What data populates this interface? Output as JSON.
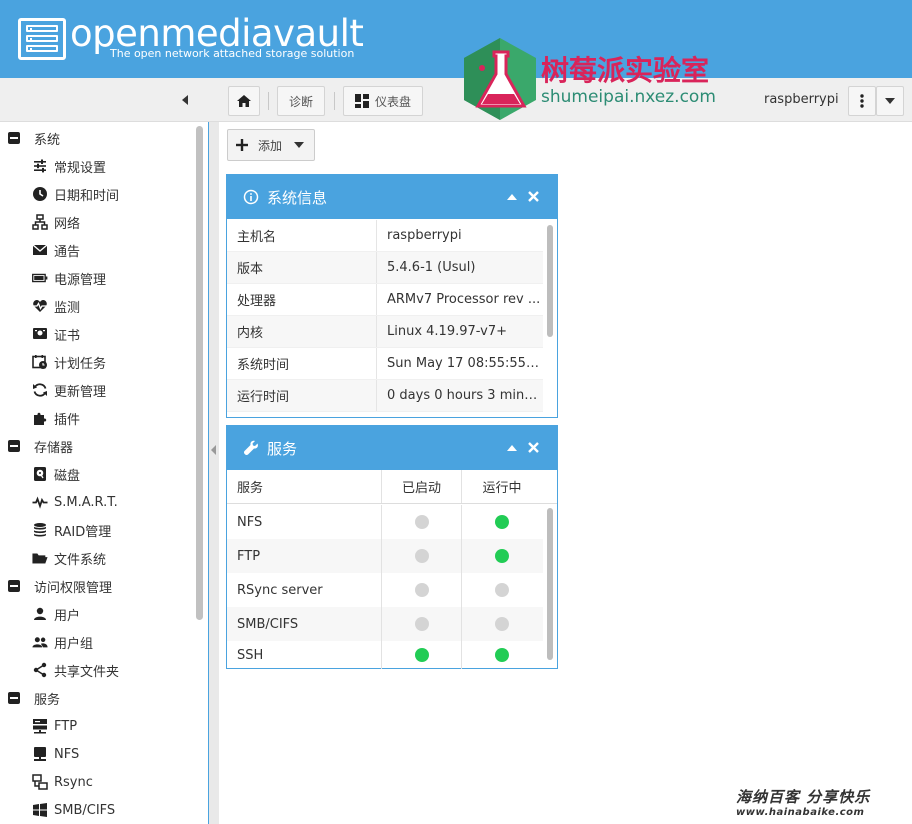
{
  "header": {
    "brand": "openmediavault",
    "tagline": "The open network attached storage solution"
  },
  "watermark": {
    "title": "树莓派实验室",
    "subtitle": "shumeipai.nxez.com"
  },
  "toolbar": {
    "diagnostics_label": "诊断",
    "dashboard_label": "仪表盘",
    "username": "raspberrypi"
  },
  "sidebar": {
    "groups": [
      {
        "label": "系统"
      },
      {
        "label": "存储器"
      },
      {
        "label": "访问权限管理"
      },
      {
        "label": "服务"
      }
    ],
    "items": [
      {
        "label": "常规设置",
        "icon": "sliders-icon"
      },
      {
        "label": "日期和时间",
        "icon": "clock-icon"
      },
      {
        "label": "网络",
        "icon": "network-icon"
      },
      {
        "label": "通告",
        "icon": "mail-icon"
      },
      {
        "label": "电源管理",
        "icon": "battery-icon"
      },
      {
        "label": "监测",
        "icon": "heartbeat-icon"
      },
      {
        "label": "证书",
        "icon": "certificate-icon"
      },
      {
        "label": "计划任务",
        "icon": "calendar-clock-icon"
      },
      {
        "label": "更新管理",
        "icon": "refresh-icon"
      },
      {
        "label": "插件",
        "icon": "puzzle-icon"
      },
      {
        "label": "磁盘",
        "icon": "disk-icon"
      },
      {
        "label": "S.M.A.R.T.",
        "icon": "pulse-icon"
      },
      {
        "label": "RAID管理",
        "icon": "database-icon"
      },
      {
        "label": "文件系统",
        "icon": "folder-icon"
      },
      {
        "label": "用户",
        "icon": "user-icon"
      },
      {
        "label": "用户组",
        "icon": "users-icon"
      },
      {
        "label": "共享文件夹",
        "icon": "share-icon"
      },
      {
        "label": "FTP",
        "icon": "server-icon"
      },
      {
        "label": "NFS",
        "icon": "monitor-icon"
      },
      {
        "label": "Rsync",
        "icon": "sync-computers-icon"
      },
      {
        "label": "SMB/CIFS",
        "icon": "windows-icon"
      }
    ]
  },
  "main": {
    "add_label": "添加",
    "sysinfo": {
      "title": "系统信息",
      "rows": [
        {
          "key": "主机名",
          "value": "raspberrypi"
        },
        {
          "key": "版本",
          "value": "5.4.6-1 (Usul)"
        },
        {
          "key": "处理器",
          "value": "ARMv7 Processor rev ..."
        },
        {
          "key": "内核",
          "value": "Linux 4.19.97-v7+"
        },
        {
          "key": "系统时间",
          "value": "Sun May 17 08:55:55 ..."
        },
        {
          "key": "运行时间",
          "value": "0 days 0 hours 3 minu..."
        }
      ]
    },
    "services": {
      "title": "服务",
      "columns": [
        "服务",
        "已启动",
        "运行中"
      ],
      "rows": [
        {
          "name": "NFS",
          "enabled": false,
          "running": true
        },
        {
          "name": "FTP",
          "enabled": false,
          "running": true
        },
        {
          "name": "RSync server",
          "enabled": false,
          "running": false
        },
        {
          "name": "SMB/CIFS",
          "enabled": false,
          "running": false
        },
        {
          "name": "SSH",
          "enabled": true,
          "running": true
        }
      ]
    }
  },
  "footer_watermark": {
    "line1": "海纳百客 分享快乐",
    "line2": "www.hainabaike.com"
  },
  "colors": {
    "accent": "#4aa3df",
    "status_on": "#22cc55",
    "status_off": "#d4d4d4"
  }
}
